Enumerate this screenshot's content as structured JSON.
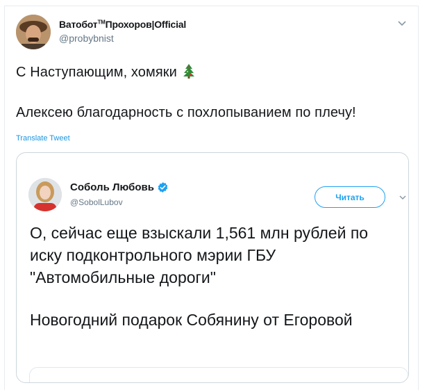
{
  "tweet": {
    "display_name": "Ватобот",
    "tm": "TM",
    "display_name_rest": "Прохоров|Official",
    "handle": "@probybnist",
    "line1": "С Наступающим, хомяки",
    "line2": "Алексею благодарность с похлопыванием по плечу!",
    "translate_label": "Translate Tweet"
  },
  "quoted": {
    "display_name": "Соболь Любовь",
    "handle": "@SobolLubov",
    "follow_label": "Читать",
    "paragraph1": "О, сейчас еще взыскали 1,561 млн рублей по иску подконтрольного мэрии ГБУ \"Автомобильные дороги\"",
    "paragraph2": "Новогодний подарок Собянину от Егоровой"
  },
  "colors": {
    "accent": "#1da1f2",
    "link": "#1b95e0",
    "secondary_text": "#657786",
    "border": "#ccd6dd"
  },
  "icons": {
    "emoji": "christmas-tree-icon",
    "verified": "verified-badge-icon",
    "menu": "chevron-down-icon"
  }
}
